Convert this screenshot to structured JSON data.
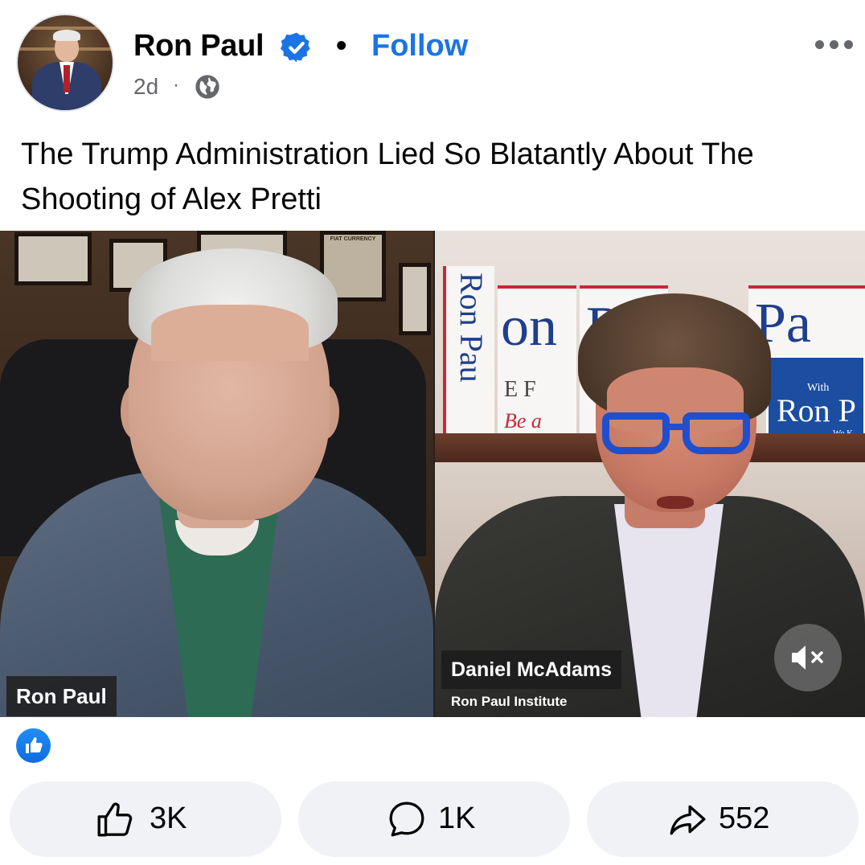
{
  "header": {
    "name": "Ron Paul",
    "separator": "•",
    "follow_label": "Follow",
    "time": "2d",
    "meta_separator": "·",
    "privacy_icon": "globe-icon",
    "verified_icon": "verified-badge-icon",
    "more_icon": "more-dots-icon"
  },
  "post": {
    "caption": "The Trump Administration Lied So Blatantly About The Shooting of Alex Pretti"
  },
  "video": {
    "left_tag": "Ron Paul",
    "right_tag": "Daniel McAdams",
    "right_subtag": "Ron Paul Institute",
    "mute_icon": "muted-speaker-icon",
    "background_signs": {
      "vertical_banner": "Ron Pau",
      "banner_1": "on",
      "banner_1b": "R",
      "banner_2": "Pa",
      "banner_3": "E F",
      "banner_4": "Be a",
      "blue_sign_small": "With",
      "blue_sign_big": "Ron P",
      "blue_sign_bottom": "We K",
      "poster_top": "FIAT CURRENCY"
    }
  },
  "reactions": {
    "like_icon": "like-reaction-icon"
  },
  "actions": {
    "like": {
      "icon": "thumbs-up-icon",
      "count": "3K"
    },
    "comment": {
      "icon": "comment-icon",
      "count": "1K"
    },
    "share": {
      "icon": "share-arrow-icon",
      "count": "552"
    }
  },
  "colors": {
    "accent": "#1b74e4",
    "text": "#050505",
    "secondary": "#65676b",
    "button_bg": "#f0f2f5"
  }
}
